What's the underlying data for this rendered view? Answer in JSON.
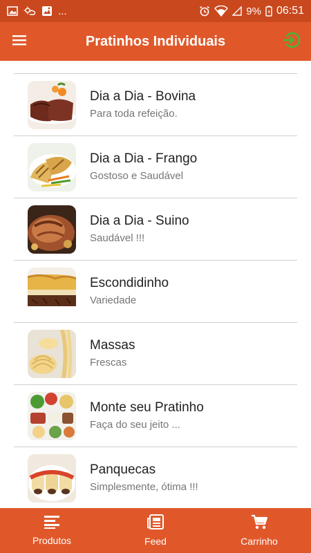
{
  "status_bar": {
    "left_icons": [
      "image-icon",
      "weather-icon",
      "gallery-icon"
    ],
    "dots": "...",
    "battery": "9%",
    "time": "06:51"
  },
  "app_bar": {
    "title": "Pratinhos Individuais",
    "menu_icon": "menu-icon",
    "action_icon": "login-icon"
  },
  "products": [
    {
      "title": "Dia a Dia - Bovina",
      "subtitle": "Para toda refeição.",
      "image": "beef-dish"
    },
    {
      "title": "Dia a Dia - Frango",
      "subtitle": "Gostoso e Saudável",
      "image": "chicken-dish"
    },
    {
      "title": "Dia a Dia - Suino",
      "subtitle": "Saudável !!!",
      "image": "pork-dish"
    },
    {
      "title": "Escondidinho",
      "subtitle": "Variedade",
      "image": "escondidinho-dish"
    },
    {
      "title": "Massas",
      "subtitle": "Frescas",
      "image": "pasta-dish"
    },
    {
      "title": "Monte seu Pratinho",
      "subtitle": "Faça do seu jeito ...",
      "image": "platter-dish"
    },
    {
      "title": "Panquecas",
      "subtitle": "Simplesmente, ótima !!!",
      "image": "pancake-dish"
    }
  ],
  "bottom_nav": [
    {
      "label": "Produtos",
      "icon": "list-icon"
    },
    {
      "label": "Feed",
      "icon": "newspaper-icon"
    },
    {
      "label": "Carrinho",
      "icon": "cart-icon"
    }
  ],
  "colors": {
    "status_bar": "#c9481e",
    "primary": "#e0582a",
    "accent_green": "#3dbb3a",
    "divider": "#cfcfcf"
  }
}
